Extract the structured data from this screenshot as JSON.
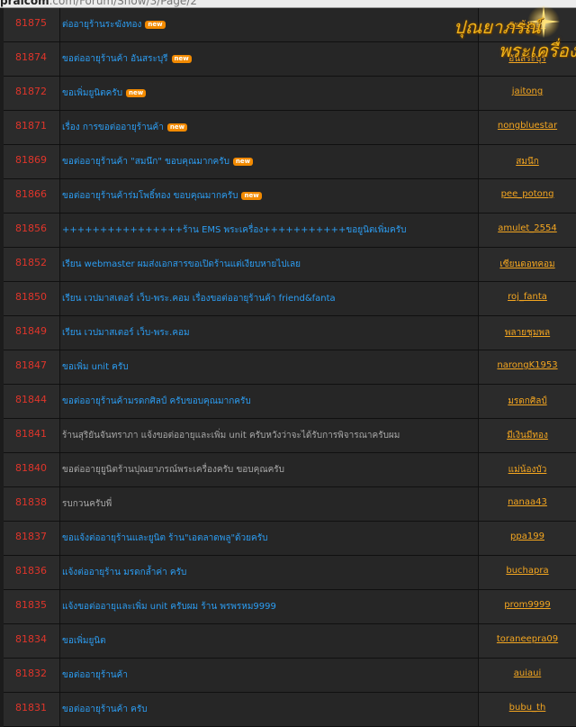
{
  "browser": {
    "host": "pralcom",
    "path": ".com/Forum/Show/3/Page/2"
  },
  "logo": {
    "line1": "ปุณยาภรณ์",
    "line2": "พระเครื่อง"
  },
  "new_badge": "new",
  "rows": [
    {
      "id": "81875",
      "title": "ต่ออายุร้านระฆังทอง",
      "new": true,
      "user": "ระฆังทอง",
      "user_partial": "ทอง"
    },
    {
      "id": "81874",
      "title": "ขอต่ออายุร้านค้า อันสระบุรี",
      "new": true,
      "user": "อันสระบุรี"
    },
    {
      "id": "81872",
      "title": "ขอเพิ่มยูนิตครับ",
      "new": true,
      "user": "jaitong"
    },
    {
      "id": "81871",
      "title": "เรื่อง การขอต่ออายุร้านค้า",
      "new": true,
      "user": "nongbluestar"
    },
    {
      "id": "81869",
      "title": "ขอต่ออายุร้านค้า \"สมนึก\" ขอบคุณมากครับ",
      "new": true,
      "user": "สมนึก"
    },
    {
      "id": "81866",
      "title": "ขอต่ออายุร้านค้าร่มโพธิ์ทอง ขอบคุณมากครับ",
      "new": true,
      "user": "pee_potong"
    },
    {
      "id": "81856",
      "title": "++++++++++++++++ร้าน EMS พระเครื่อง+++++++++++ขอยูนิตเพิ่มครับ",
      "new": false,
      "user": "amulet_2554"
    },
    {
      "id": "81852",
      "title": "เรียน webmaster ผมส่งเอกสารขอเปิดร้านแต่เงียบหายไปเลย",
      "new": false,
      "user": "เซียนดอทคอม"
    },
    {
      "id": "81850",
      "title": "เรียน เวปมาสเตอร์ เว็บ-พระ.คอม เรื่องขอต่ออายุร้านค้า friend&fanta",
      "new": false,
      "user": "roj_fanta"
    },
    {
      "id": "81849",
      "title": "เรียน เวปมาสเตอร์ เว็บ-พระ.คอม",
      "new": false,
      "user": "พลายชุมพล"
    },
    {
      "id": "81847",
      "title": "ขอเพิ่ม unit ครับ",
      "new": false,
      "user": "narongK1953"
    },
    {
      "id": "81844",
      "title": "ขอต่ออายุร้านค้ามรดกศิลป์ ครับขอบคุณมากครับ",
      "new": false,
      "user": "มรดกศิลป์"
    },
    {
      "id": "81841",
      "title": "ร้านสุริยันจันทราภา แจ้งขอต่ออายุและเพิ่ม unit ครับหวังว่าจะได้รับการพิจารณาครับผม",
      "new": false,
      "muted": true,
      "user": "มีเงินมีทอง"
    },
    {
      "id": "81840",
      "title": "ขอต่ออายุยูนิตร้านปุณยาภรณ์พระเครื่องครับ ขอบคุณครับ",
      "new": false,
      "muted": true,
      "user": "แม่น้องบัว"
    },
    {
      "id": "81838",
      "title": "รบกวนครับพี่",
      "new": false,
      "muted": true,
      "user": "nanaa43"
    },
    {
      "id": "81837",
      "title": "ขอแจ้งต่ออายุร้านและยูนิต ร้าน\"เอตลาดพลู\"ด้วยครับ",
      "new": false,
      "user": "ppa199"
    },
    {
      "id": "81836",
      "title": "แจ้งต่ออายุร้าน มรดกล้ำค่า ครับ",
      "new": false,
      "user": "buchapra"
    },
    {
      "id": "81835",
      "title": "แจ้งขอต่ออายุและเพิ่ม unit ครับผม ร้าน พรพรหม9999",
      "new": false,
      "user": "prom9999"
    },
    {
      "id": "81834",
      "title": "ขอเพิ่มยูนิต",
      "new": false,
      "user": "toraneepra09"
    },
    {
      "id": "81832",
      "title": "ขอต่ออายุร้านค้า",
      "new": false,
      "user": "auiaui"
    },
    {
      "id": "81831",
      "title": "ขอต่ออายุร้านค้า ครับ",
      "new": false,
      "user": "bubu_th"
    }
  ]
}
